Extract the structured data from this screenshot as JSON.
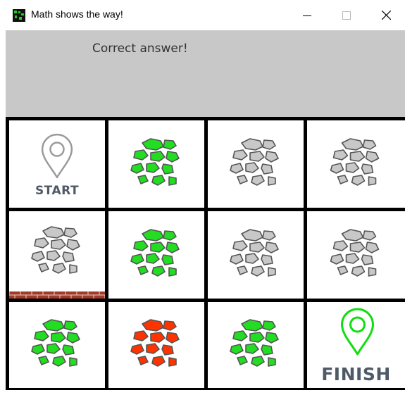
{
  "window": {
    "title": "Math shows the way!",
    "controls": {
      "minimize_icon": "minimize-icon",
      "maximize_icon": "maximize-icon",
      "close_icon": "close-icon"
    }
  },
  "message": "Correct answer!",
  "board": {
    "rows": 3,
    "cols": 4,
    "cells": [
      {
        "row": 0,
        "col": 0,
        "type": "start",
        "label": "START"
      },
      {
        "row": 0,
        "col": 1,
        "type": "stones",
        "state": "correct"
      },
      {
        "row": 0,
        "col": 2,
        "type": "stones",
        "state": "unvisited"
      },
      {
        "row": 0,
        "col": 3,
        "type": "stones",
        "state": "unvisited"
      },
      {
        "row": 1,
        "col": 0,
        "type": "stones",
        "state": "unvisited",
        "wall": "bottom"
      },
      {
        "row": 1,
        "col": 1,
        "type": "stones",
        "state": "correct"
      },
      {
        "row": 1,
        "col": 2,
        "type": "stones",
        "state": "unvisited"
      },
      {
        "row": 1,
        "col": 3,
        "type": "stones",
        "state": "unvisited"
      },
      {
        "row": 2,
        "col": 0,
        "type": "stones",
        "state": "correct"
      },
      {
        "row": 2,
        "col": 1,
        "type": "stones",
        "state": "wrong"
      },
      {
        "row": 2,
        "col": 2,
        "type": "stones",
        "state": "correct"
      },
      {
        "row": 2,
        "col": 3,
        "type": "finish",
        "label": "FINISH"
      }
    ]
  },
  "colors": {
    "correct": "#22dd22",
    "wrong": "#ff3300",
    "unvisited": "#c8c8c8",
    "stone_outline": "#555555",
    "wall": "#a23a2a",
    "start_pin": "#9a9a9a",
    "finish_pin": "#11dd11",
    "message_bg": "#c8c8c8"
  }
}
